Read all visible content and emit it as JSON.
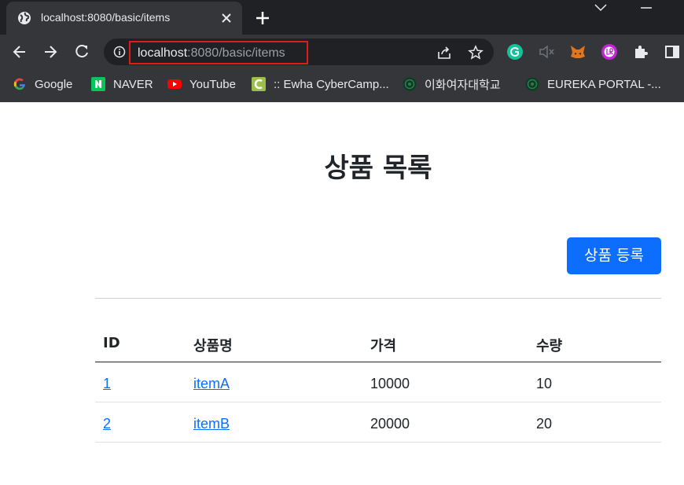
{
  "browser": {
    "tab_title": "localhost:8080/basic/items",
    "url_host": "localhost",
    "url_rest": ":8080/basic/items",
    "bookmarks": [
      {
        "label": "Google",
        "icon": "google-icon"
      },
      {
        "label": "NAVER",
        "icon": "naver-icon"
      },
      {
        "label": "YouTube",
        "icon": "youtube-icon"
      },
      {
        "label": ":: Ewha CyberCamp...",
        "icon": "cybercampus-icon"
      },
      {
        "label": "이화여자대학교",
        "icon": "ewha-emblem-icon"
      },
      {
        "label": "EUREKA PORTAL -...",
        "icon": "ewha-emblem-icon"
      }
    ],
    "extensions": [
      "grammarly-icon",
      "mute-icon",
      "metamask-icon",
      "reader-icon",
      "puzzle-icon",
      "side-panel-icon"
    ]
  },
  "page": {
    "title": "상품 목록",
    "add_button": "상품 등록",
    "columns": [
      "ID",
      "상품명",
      "가격",
      "수량"
    ],
    "rows": [
      {
        "id": "1",
        "name": "itemA",
        "price": "10000",
        "quantity": "10"
      },
      {
        "id": "2",
        "name": "itemB",
        "price": "20000",
        "quantity": "20"
      }
    ]
  },
  "colors": {
    "accent": "#0d6efd",
    "highlight_box": "#e21a1a",
    "chrome_dark": "#202124",
    "chrome": "#35363a"
  }
}
